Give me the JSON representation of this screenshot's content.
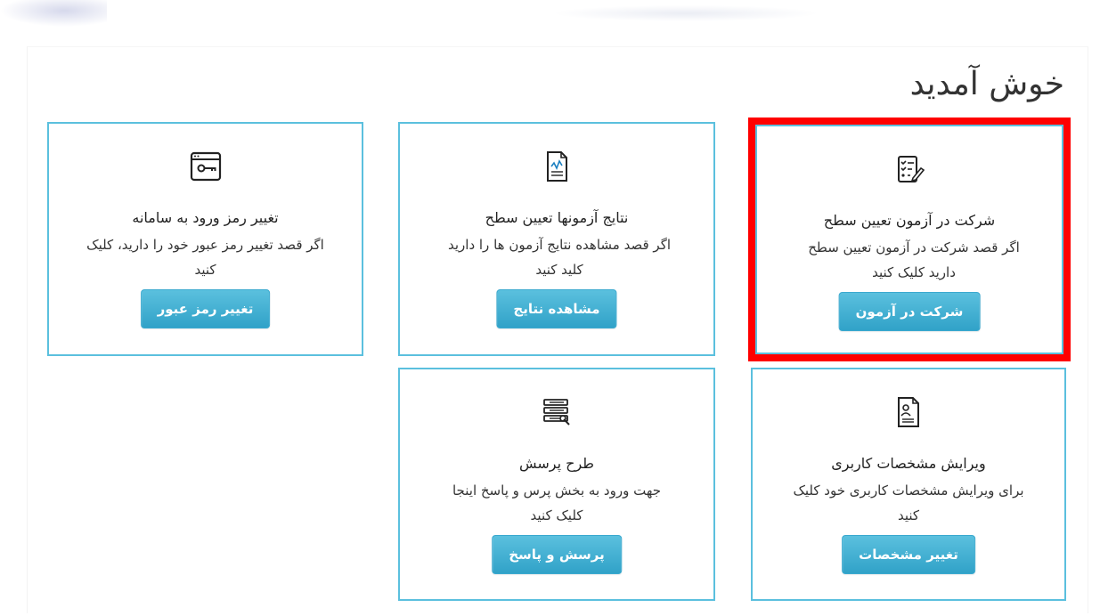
{
  "header": {
    "welcome": "خوش آمدید"
  },
  "cards": [
    {
      "title": "شرکت در آزمون تعیین سطح",
      "desc": "اگر قصد شرکت در آزمون تعیین سطح دارید کلیک کنید",
      "button": "شرکت در آزمون",
      "icon": "checklist-edit-icon"
    },
    {
      "title": "نتایج آزمونها تعیین سطح",
      "desc": "اگر قصد مشاهده نتایج آزمون ها را دارید کلید کنید",
      "button": "مشاهده نتایج",
      "icon": "document-chart-icon"
    },
    {
      "title": "تغییر رمز ورود به سامانه",
      "desc": "اگر قصد تغییر رمز عبور خود را دارید، کلیک کنید",
      "button": "تغییر رمز عبور",
      "icon": "browser-key-icon"
    },
    {
      "title": "ویرایش مشخصات کاربری",
      "desc": "برای ویرایش مشخصات کاربری خود کلیک کنید",
      "button": "تغییر مشخصات",
      "icon": "profile-document-icon"
    },
    {
      "title": "طرح پرسش",
      "desc": "جهت ورود به بخش پرس و پاسخ اینجا کلیک کنید",
      "button": "پرسش و پاسخ",
      "icon": "list-questions-icon"
    }
  ],
  "colors": {
    "card_border": "#5bc0de",
    "button": "#5bc0de",
    "highlight": "#ff0000"
  }
}
